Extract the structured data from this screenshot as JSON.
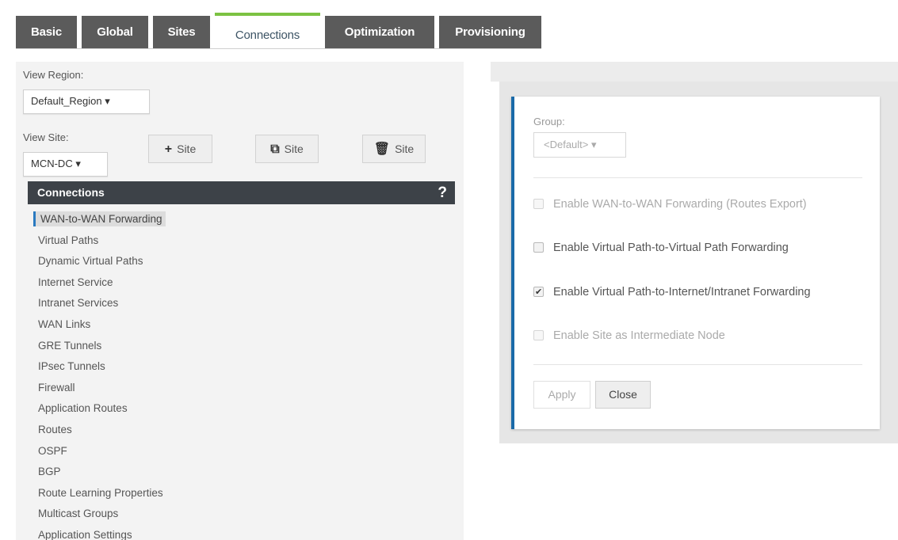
{
  "tabs": [
    {
      "label": "Basic",
      "active": false
    },
    {
      "label": "Global",
      "active": false
    },
    {
      "label": "Sites",
      "active": false
    },
    {
      "label": "Connections",
      "active": true
    },
    {
      "label": "Optimization",
      "active": false
    },
    {
      "label": "Provisioning",
      "active": false
    }
  ],
  "region": {
    "label": "View Region:",
    "value": "Default_Region ▾"
  },
  "site": {
    "label": "View Site:",
    "value": "MCN-DC ▾"
  },
  "site_buttons": {
    "add": {
      "icon": "+",
      "label": "Site"
    },
    "clone": {
      "icon": "⧉",
      "label": "Site"
    },
    "delete": {
      "icon": "🗑",
      "label": "Site"
    }
  },
  "connections": {
    "title": "Connections",
    "help": "?",
    "items": [
      "WAN-to-WAN Forwarding",
      "Virtual Paths",
      "Dynamic Virtual Paths",
      "Internet Service",
      "Intranet Services",
      "WAN Links",
      "GRE Tunnels",
      "IPsec Tunnels",
      "Firewall",
      "Application Routes",
      "Routes",
      "OSPF",
      "BGP",
      "Route Learning Properties",
      "Multicast Groups",
      "Application Settings"
    ],
    "active_index": 0
  },
  "panel": {
    "group_label": "Group:",
    "group_value": "<Default> ▾",
    "options": [
      {
        "label": "Enable WAN-to-WAN Forwarding (Routes Export)",
        "checked": false,
        "disabled": true
      },
      {
        "label": "Enable Virtual Path-to-Virtual Path Forwarding",
        "checked": false,
        "disabled": false
      },
      {
        "label": "Enable Virtual Path-to-Internet/Intranet Forwarding",
        "checked": true,
        "disabled": false
      },
      {
        "label": "Enable Site as Intermediate Node",
        "checked": false,
        "disabled": true
      }
    ],
    "apply_label": "Apply",
    "close_label": "Close"
  },
  "colors": {
    "tab_bg": "#5b5b5b",
    "tab_active_accent": "#7cc242",
    "panel_accent": "#1a6aa8",
    "header_bg": "#3d4248"
  }
}
